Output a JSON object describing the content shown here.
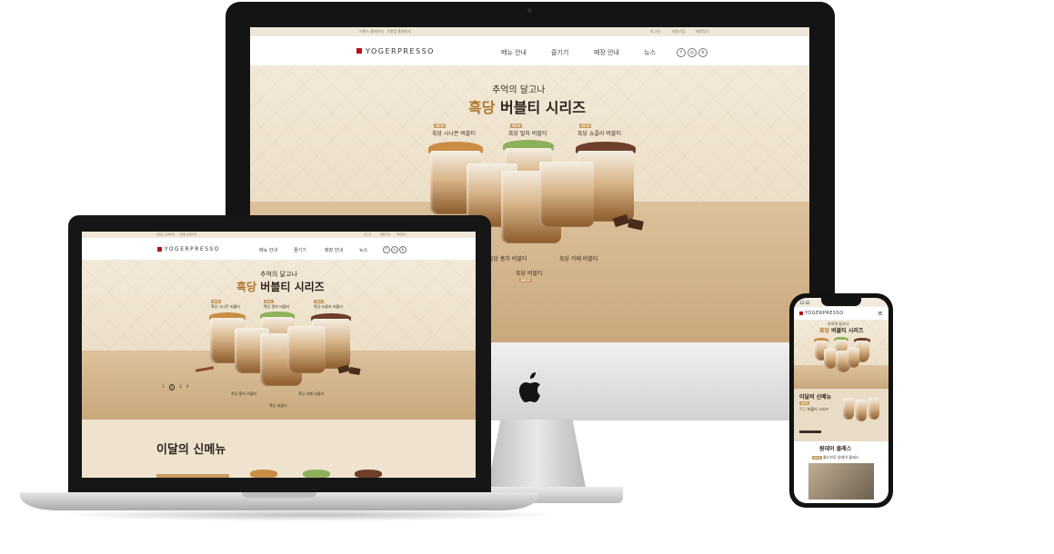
{
  "site": {
    "brand": "YOGERPRESSO",
    "top_links_left": [
      "브랜드 홈페이지",
      "가맹점 홈페이지"
    ],
    "top_links_right": [
      "로그인",
      "회원가입",
      "매장찾기"
    ],
    "nav": [
      "메뉴 안내",
      "즐기기",
      "매장 안내",
      "뉴스"
    ],
    "social_icons": [
      "facebook-icon",
      "instagram-icon",
      "blog-icon"
    ]
  },
  "hero": {
    "subtitle": "추억의 달고나",
    "title_accent": "흑당",
    "title_rest": "버블티 시리즈",
    "badge_new": "NEW",
    "badge_best": "BEST",
    "products_top": [
      "흑당 시나몬 버블티",
      "흑당 말차 버블티",
      "흑당 쇼콜라 버블티"
    ],
    "products_bottom": [
      "흑당 홍차 버블티",
      "흑당 버블티",
      "흑당 카페 버블티"
    ],
    "pagination": [
      "1",
      "2",
      "3",
      "4"
    ]
  },
  "sections": {
    "new_menu": "이달의 신메뉴",
    "oneday_class": "원데이 클래스",
    "class_item": "콜드브루 원데이 클래스",
    "class_badge": "NEW"
  },
  "phone": {
    "time": "12:42"
  },
  "colors": {
    "brand_red": "#b5121b",
    "accent_brown": "#b0762b",
    "cream": "#efe3cf"
  }
}
